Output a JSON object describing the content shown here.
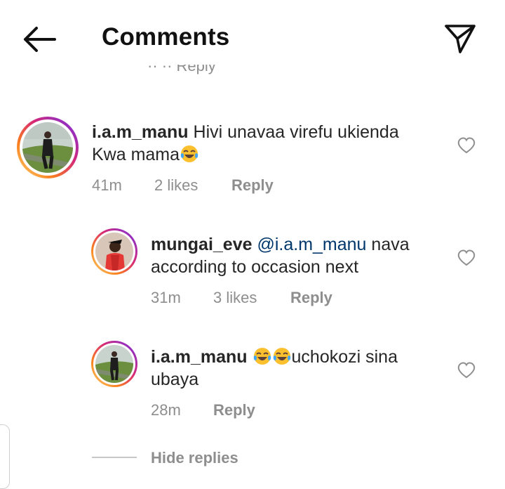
{
  "header": {
    "title": "Comments"
  },
  "partial_row": {
    "text": "·· ·· Reply"
  },
  "comments": [
    {
      "username": "i.a.m_manu",
      "text_line1": "Hivi unavaa virefu ukienda",
      "text_line2": "Kwa mama",
      "emojis": [
        "face-with-tears-of-joy"
      ],
      "time": "41m",
      "likes": "2 likes",
      "reply": "Reply"
    },
    {
      "username": "mungai_eve",
      "mention": "@i.a.m_manu",
      "text_line1": "nava",
      "text_line2": "according to occasion next",
      "time": "31m",
      "likes": "3 likes",
      "reply": "Reply"
    },
    {
      "username": "i.a.m_manu",
      "emojis": [
        "face-with-tears-of-joy",
        "face-with-tears-of-joy"
      ],
      "text_line1": "uchokozi sina",
      "text_line2": "ubaya",
      "time": "28m",
      "reply": "Reply"
    }
  ],
  "hide_replies": "Hide replies",
  "icons": {
    "back": "arrow-left-icon",
    "send": "paper-plane-icon",
    "like": "heart-outline-icon"
  },
  "colors": {
    "mention": "#00376b",
    "meta": "#8e8e8e",
    "text": "#262626"
  }
}
